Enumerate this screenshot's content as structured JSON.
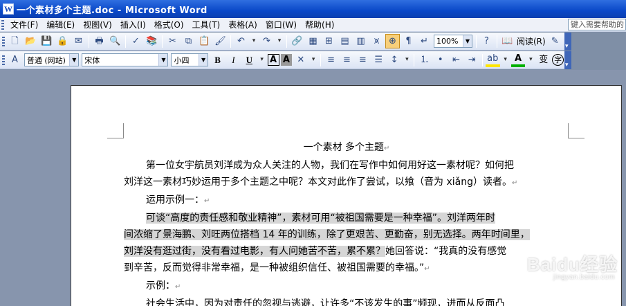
{
  "window": {
    "title": "一个素材多个主题.doc - Microsoft Word",
    "app_icon": "W"
  },
  "menu": {
    "items": [
      "文件(F)",
      "编辑(E)",
      "视图(V)",
      "插入(I)",
      "格式(O)",
      "工具(T)",
      "表格(A)",
      "窗口(W)",
      "帮助(H)"
    ],
    "help_placeholder": "键入需要帮助的"
  },
  "standard_toolbar": {
    "zoom": "100%",
    "read_label": "阅读(R)"
  },
  "formatting_toolbar": {
    "style": "普通 (网站)",
    "font": "宋体",
    "size": "小四",
    "bold": "B",
    "italic": "I",
    "underline": "U",
    "char_border": "A",
    "char_shading": "A",
    "phonetic": "变",
    "enclosed": "字"
  },
  "document": {
    "title": "一个素材  多个主题",
    "para1_line1": "第一位女宇航员刘洋成为众人关注的人物，我们在写作中如何用好这一素材呢？如何把",
    "para1_line2": "刘洋这一素材巧妙运用于多个主题之中呢？本文对此作了尝试，以飨（音为 xiǎng）读者。",
    "example1_label": "运用示例一：",
    "para2_line1": "可谈“高度的责任感和敬业精神”，素材可用“被祖国需要是一种幸福”。刘洋两年时",
    "para2_line2": "间浓缩了景海鹏、刘旺两位搭档 14 年的训练，除了更艰苦、更勤奋，别无选择。两年时间里，",
    "para2_line3a": "刘洋没有逛过街，没有看过电影，有人问她苦不苦，累不累？",
    "para2_line3b": "她回答说：“我真的没有感觉",
    "para2_line4": "到辛苦，反而觉得非常幸福，是一种被组织信任、被祖国需要的幸福。”",
    "example_label": "示例：",
    "para3_line1": "社会生活中，因为对责任的忽视与逃避，让许多“不该发生的事”频现，进而从反面凸",
    "para_mark": "↵"
  },
  "watermark": {
    "brand": "Baidu经验",
    "url": "jingyan.baidu.com"
  }
}
